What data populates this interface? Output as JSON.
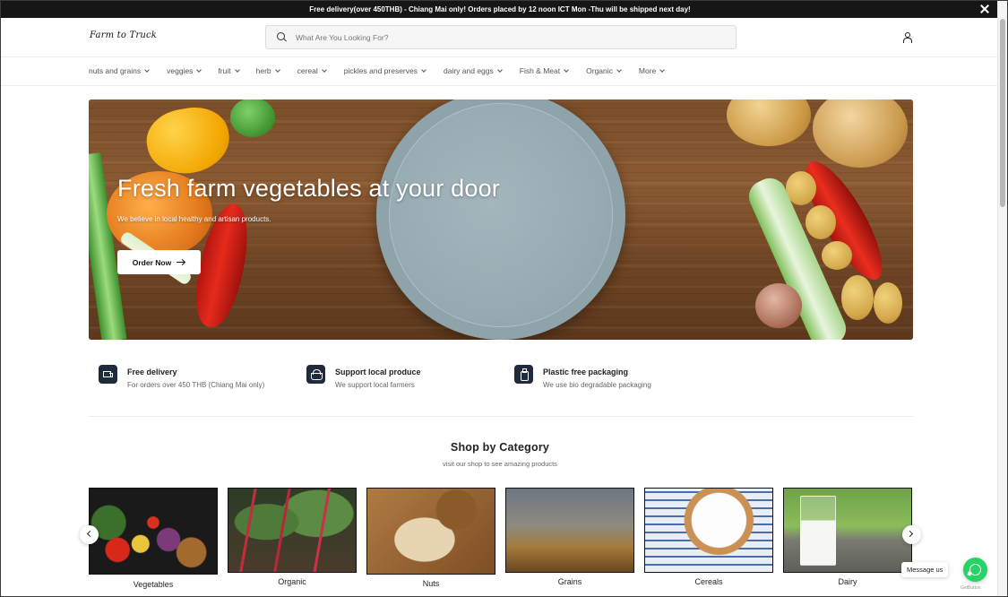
{
  "announcement": {
    "text": "Free delivery(over 450THB) - Chiang Mai only! Orders placed by 12 noon ICT Mon -Thu will be shipped next day!"
  },
  "header": {
    "logo_text": "Farm to Truck",
    "search_placeholder": "What Are You Looking For?"
  },
  "nav": {
    "items": [
      {
        "label": "nuts and grains"
      },
      {
        "label": "veggies"
      },
      {
        "label": "fruit"
      },
      {
        "label": "herb"
      },
      {
        "label": "cereal"
      },
      {
        "label": "pickles and preserves"
      },
      {
        "label": "dairy and eggs"
      },
      {
        "label": "Fish & Meat"
      },
      {
        "label": "Organic"
      },
      {
        "label": "More"
      }
    ]
  },
  "hero": {
    "title": "Fresh farm vegetables at your door",
    "subtitle": "We believe in local healthy and artisan products.",
    "button_label": "Order Now"
  },
  "features": [
    {
      "title": "Free delivery",
      "desc": "For orders over 450 THB (Chiang Mai only)",
      "icon": "truck-icon"
    },
    {
      "title": "Support local produce",
      "desc": "We support local farmers",
      "icon": "basket-icon"
    },
    {
      "title": "Plastic free packaging",
      "desc": "We use bio degradable packaging",
      "icon": "bottle-icon"
    }
  ],
  "categories": {
    "title": "Shop by Category",
    "subtitle": "visit our shop to see amazing products",
    "items": [
      {
        "label": "Vegetables"
      },
      {
        "label": "Organic"
      },
      {
        "label": "Nuts"
      },
      {
        "label": "Grains"
      },
      {
        "label": "Cereals"
      },
      {
        "label": "Dairy"
      }
    ]
  },
  "chat": {
    "message_label": "Message us",
    "powered_label": "GetButton"
  },
  "colors": {
    "announcement_bg": "#161616",
    "feature_icon_bg": "#1f2a3a",
    "whatsapp_green": "#25d366"
  }
}
